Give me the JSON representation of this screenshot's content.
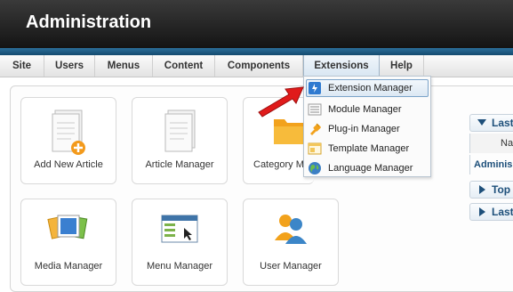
{
  "header": {
    "title": "Administration"
  },
  "menu": {
    "items": [
      {
        "label": "Site"
      },
      {
        "label": "Users"
      },
      {
        "label": "Menus"
      },
      {
        "label": "Content"
      },
      {
        "label": "Components"
      },
      {
        "label": "Extensions"
      },
      {
        "label": "Help"
      }
    ],
    "active": "Extensions"
  },
  "extensions_dropdown": {
    "items": [
      {
        "label": "Extension Manager",
        "icon": "extension-manager-icon",
        "highlighted": true
      },
      {
        "label": "Module Manager",
        "icon": "module-manager-icon"
      },
      {
        "label": "Plug-in Manager",
        "icon": "plugin-manager-icon"
      },
      {
        "label": "Template Manager",
        "icon": "template-manager-icon"
      },
      {
        "label": "Language Manager",
        "icon": "language-manager-icon"
      }
    ]
  },
  "quickicons": {
    "row1": [
      {
        "label": "Add New Article",
        "icon": "add-article-icon"
      },
      {
        "label": "Article Manager",
        "icon": "article-manager-icon"
      },
      {
        "label": "Category Ma",
        "icon": "category-manager-icon"
      }
    ],
    "row2": [
      {
        "label": "Media Manager",
        "icon": "media-manager-icon"
      },
      {
        "label": "Menu Manager",
        "icon": "menu-manager-icon"
      },
      {
        "label": "User Manager",
        "icon": "user-manager-icon"
      }
    ]
  },
  "right_panels": {
    "panel1": {
      "title": "Last",
      "col": "Na",
      "row": "Adminis"
    },
    "panel2": {
      "title": "Top"
    },
    "panel3": {
      "title": "Last"
    }
  },
  "colors": {
    "accent": "#1d4f7a",
    "arrow": "#e01b1b",
    "folder": "#f2a21c"
  }
}
